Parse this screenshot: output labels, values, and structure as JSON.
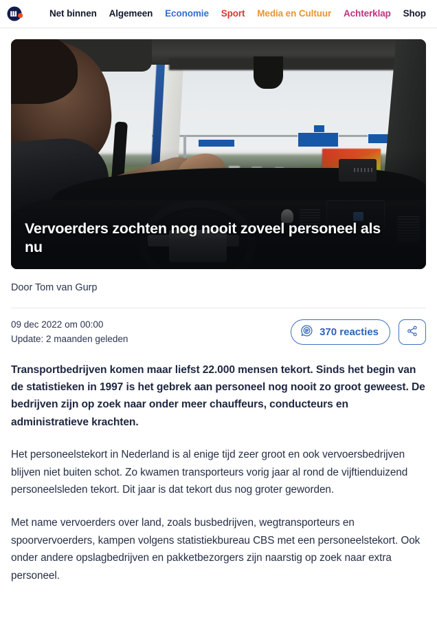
{
  "header": {
    "logo_name": "nu-logo",
    "nav": [
      {
        "label": "Net binnen",
        "color": "#12182b",
        "active": false
      },
      {
        "label": "Algemeen",
        "color": "#12182b",
        "active": false
      },
      {
        "label": "Economie",
        "color": "#2f6fd0",
        "active": true
      },
      {
        "label": "Sport",
        "color": "#d8392b",
        "active": false
      },
      {
        "label": "Media en Cultuur",
        "color": "#e89432",
        "active": false
      },
      {
        "label": "Achterklap",
        "color": "#c2307e",
        "active": false
      },
      {
        "label": "Shop",
        "color": "#12182b",
        "active": false
      }
    ]
  },
  "hero": {
    "title": "Vervoerders zochten nog nooit zoveel personeel als nu",
    "alt": "Truckchauffeur achter het stuur op de snelweg"
  },
  "byline": {
    "text": "Door Tom van Gurp"
  },
  "meta": {
    "published": "09 dec 2022 om 00:00",
    "updated": "Update: 2 maanden geleden",
    "reactions_label": "370 reacties",
    "reactions_count": "370",
    "share_label": "Delen",
    "accent": "#2d63bb"
  },
  "article": {
    "lead": "Transportbedrijven komen maar liefst 22.000 mensen tekort. Sinds het begin van de statistieken in 1997 is het gebrek aan personeel nog nooit zo groot geweest. De bedrijven zijn op zoek naar onder meer chauffeurs, conducteurs en administratieve krachten.",
    "paragraphs": [
      "Het personeelstekort in Nederland is al enige tijd zeer groot en ook vervoersbedrijven blijven niet buiten schot. Zo kwamen transporteurs vorig jaar al rond de vijftienduizend personeelsleden tekort. Dit jaar is dat tekort dus nog groter geworden.",
      "Met name vervoerders over land, zoals busbedrijven, wegtransporteurs en spoorvervoerders, kampen volgens statistiekbureau CBS met een personeelstekort. Ook onder andere opslagbedrijven en pakketbezorgers zijn naarstig op zoek naar extra personeel."
    ]
  }
}
